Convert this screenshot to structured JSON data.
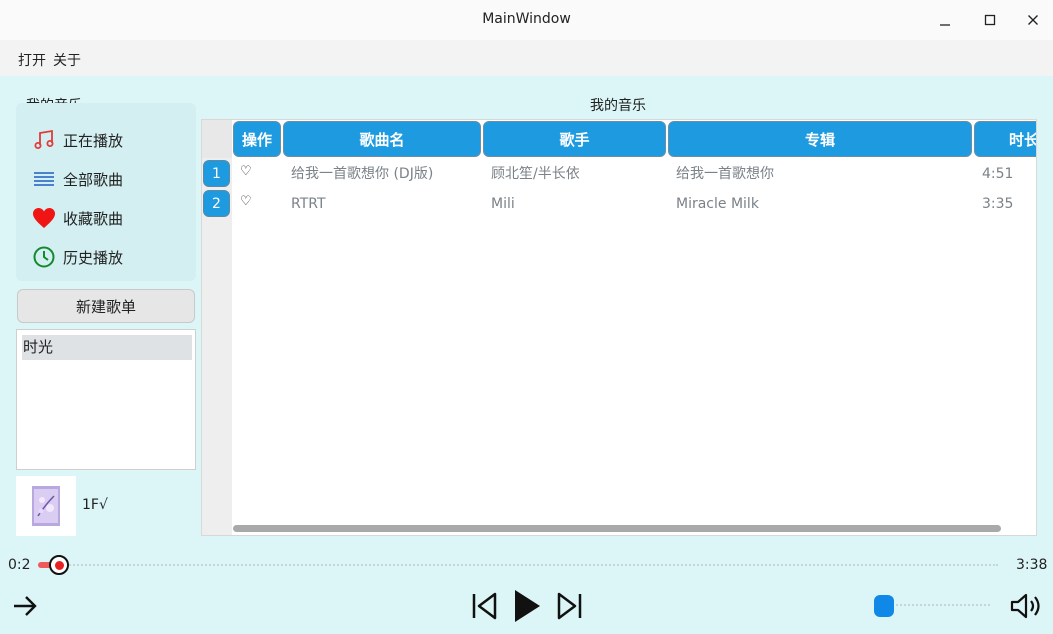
{
  "window": {
    "title": "MainWindow"
  },
  "menu": {
    "open": "打开",
    "about": "关于"
  },
  "sidebar": {
    "header": "我的音乐",
    "items": [
      {
        "label": "正在播放",
        "icon": "music-note-icon"
      },
      {
        "label": "全部歌曲",
        "icon": "list-icon"
      },
      {
        "label": "收藏歌曲",
        "icon": "heart-icon"
      },
      {
        "label": "历史播放",
        "icon": "clock-icon"
      }
    ],
    "new_playlist": "新建歌单",
    "playlists": [
      "时光"
    ]
  },
  "now_playing": {
    "title": "1F√"
  },
  "table": {
    "title": "我的音乐",
    "columns": [
      "操作",
      "歌曲名",
      "歌手",
      "专辑",
      "时长"
    ],
    "rows": [
      {
        "num": "1",
        "song": "给我一首歌想你 (DJ版)",
        "artist": "顾北笙/半长依",
        "album": "给我一首歌想你",
        "duration": "4:51"
      },
      {
        "num": "2",
        "song": "RTRT",
        "artist": "Mili",
        "album": "Miracle Milk",
        "duration": "3:35"
      }
    ]
  },
  "player": {
    "current_time": "0:2",
    "total_time": "3:38",
    "progress_fraction": 0.01,
    "volume_fraction": 0.0
  },
  "colors": {
    "accent": "#1e9be0",
    "progress": "#f05a5a",
    "background": "#dcf5f7"
  }
}
